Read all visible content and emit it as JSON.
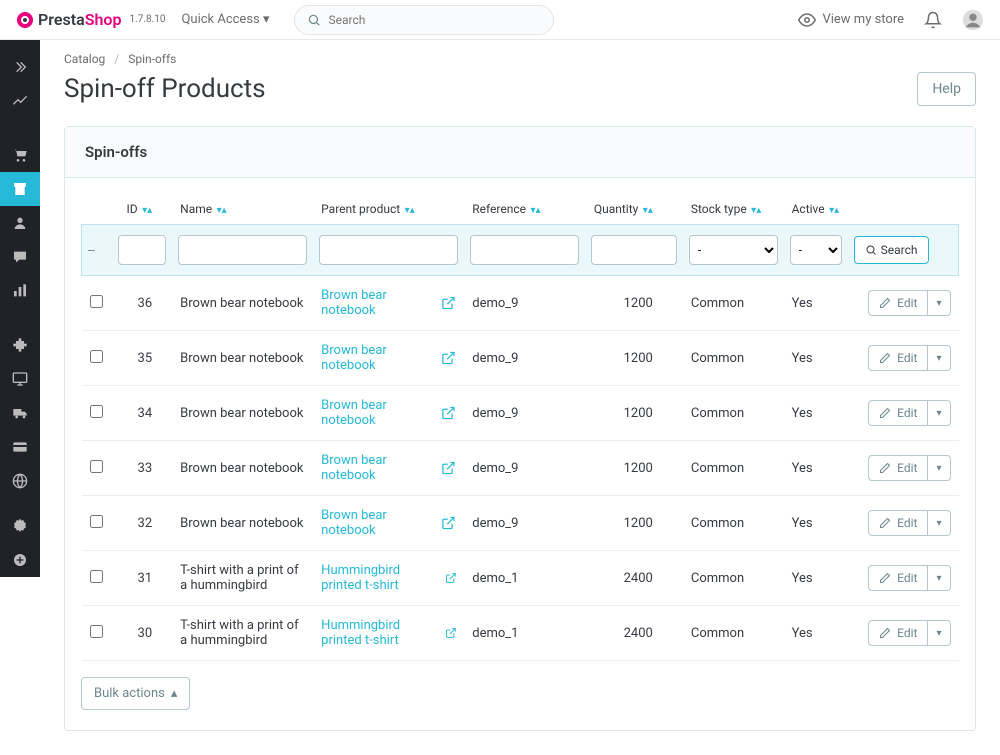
{
  "header": {
    "logo_presta": "Presta",
    "logo_shop": "Shop",
    "version": "1.7.8.10",
    "quick_access": "Quick Access",
    "search_placeholder": "Search",
    "view_store": "View my store"
  },
  "breadcrumb": {
    "parent": "Catalog",
    "current": "Spin-offs"
  },
  "page": {
    "title": "Spin-off Products",
    "help": "Help"
  },
  "panel": {
    "heading": "Spin-offs",
    "search": "Search",
    "edit": "Edit",
    "bulk": "Bulk actions"
  },
  "columns": {
    "id": "ID",
    "name": "Name",
    "parent": "Parent product",
    "reference": "Reference",
    "quantity": "Quantity",
    "stock_type": "Stock type",
    "active": "Active"
  },
  "filter_select": {
    "dash": "-"
  },
  "rows": [
    {
      "id": "36",
      "name": "Brown bear notebook",
      "parent": "Brown bear notebook",
      "reference": "demo_9",
      "quantity": "1200",
      "stock_type": "Common",
      "active": "Yes"
    },
    {
      "id": "35",
      "name": "Brown bear notebook",
      "parent": "Brown bear notebook",
      "reference": "demo_9",
      "quantity": "1200",
      "stock_type": "Common",
      "active": "Yes"
    },
    {
      "id": "34",
      "name": "Brown bear notebook",
      "parent": "Brown bear notebook",
      "reference": "demo_9",
      "quantity": "1200",
      "stock_type": "Common",
      "active": "Yes"
    },
    {
      "id": "33",
      "name": "Brown bear notebook",
      "parent": "Brown bear notebook",
      "reference": "demo_9",
      "quantity": "1200",
      "stock_type": "Common",
      "active": "Yes"
    },
    {
      "id": "32",
      "name": "Brown bear notebook",
      "parent": "Brown bear notebook",
      "reference": "demo_9",
      "quantity": "1200",
      "stock_type": "Common",
      "active": "Yes"
    },
    {
      "id": "31",
      "name": "T-shirt with a print of a hummingbird",
      "parent": "Hummingbird printed t-shirt",
      "reference": "demo_1",
      "quantity": "2400",
      "stock_type": "Common",
      "active": "Yes"
    },
    {
      "id": "30",
      "name": "T-shirt with a print of a hummingbird",
      "parent": "Hummingbird printed t-shirt",
      "reference": "demo_1",
      "quantity": "2400",
      "stock_type": "Common",
      "active": "Yes"
    }
  ]
}
